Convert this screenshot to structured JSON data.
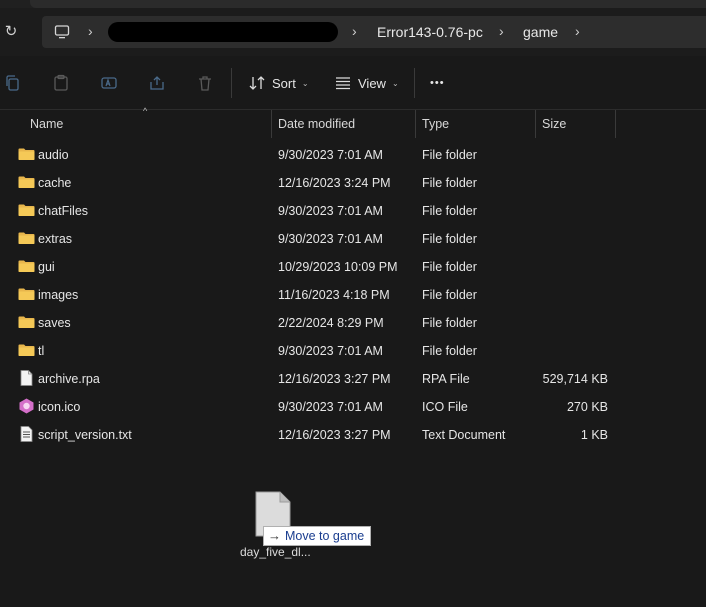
{
  "address": {
    "crumbs": [
      "Error143-0.76-pc",
      "game"
    ],
    "separator": "›"
  },
  "toolbar": {
    "sort_label": "Sort",
    "view_label": "View",
    "more_label": "•••"
  },
  "columns": {
    "name": "Name",
    "date": "Date modified",
    "type": "Type",
    "size": "Size"
  },
  "files": [
    {
      "name": "audio",
      "date": "9/30/2023 7:01 AM",
      "type": "File folder",
      "size": "",
      "icon": "folder-icon"
    },
    {
      "name": "cache",
      "date": "12/16/2023 3:24 PM",
      "type": "File folder",
      "size": "",
      "icon": "folder-icon"
    },
    {
      "name": "chatFiles",
      "date": "9/30/2023 7:01 AM",
      "type": "File folder",
      "size": "",
      "icon": "folder-icon"
    },
    {
      "name": "extras",
      "date": "9/30/2023 7:01 AM",
      "type": "File folder",
      "size": "",
      "icon": "folder-icon"
    },
    {
      "name": "gui",
      "date": "10/29/2023 10:09 PM",
      "type": "File folder",
      "size": "",
      "icon": "folder-icon"
    },
    {
      "name": "images",
      "date": "11/16/2023 4:18 PM",
      "type": "File folder",
      "size": "",
      "icon": "folder-icon"
    },
    {
      "name": "saves",
      "date": "2/22/2024 8:29 PM",
      "type": "File folder",
      "size": "",
      "icon": "folder-icon"
    },
    {
      "name": "tl",
      "date": "9/30/2023 7:01 AM",
      "type": "File folder",
      "size": "",
      "icon": "folder-icon"
    },
    {
      "name": "archive.rpa",
      "date": "12/16/2023 3:27 PM",
      "type": "RPA File",
      "size": "529,714 KB",
      "icon": "file-icon"
    },
    {
      "name": "icon.ico",
      "date": "9/30/2023 7:01 AM",
      "type": "ICO File",
      "size": "270 KB",
      "icon": "ico-file-icon"
    },
    {
      "name": "script_version.txt",
      "date": "12/16/2023 3:27 PM",
      "type": "Text Document",
      "size": "1 KB",
      "icon": "text-file-icon"
    }
  ],
  "drag": {
    "tooltip": "Move to game",
    "file_label": "day_five_dl..."
  }
}
